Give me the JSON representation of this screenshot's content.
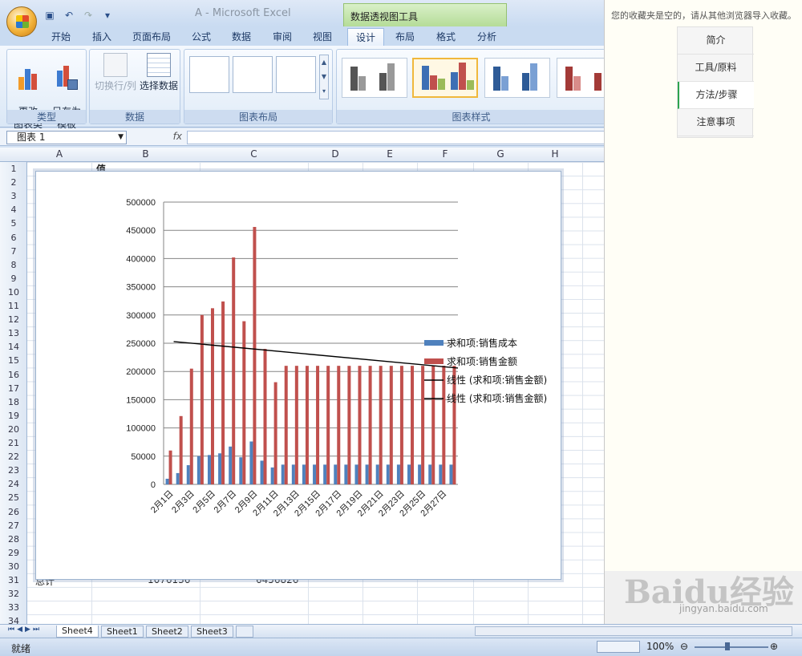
{
  "window": {
    "title": "A - Microsoft Excel",
    "context_tools": "数据透视图工具"
  },
  "qat": {
    "save_icon": "save-icon",
    "undo_icon": "undo-icon",
    "redo_icon": "redo-icon",
    "customize_icon": "dropdown-icon"
  },
  "tabs": [
    {
      "label": "开始"
    },
    {
      "label": "插入"
    },
    {
      "label": "页面布局"
    },
    {
      "label": "公式"
    },
    {
      "label": "数据"
    },
    {
      "label": "审阅"
    },
    {
      "label": "视图"
    },
    {
      "label": "设计"
    },
    {
      "label": "布局"
    },
    {
      "label": "格式"
    },
    {
      "label": "分析"
    }
  ],
  "ribbon": {
    "type_group": {
      "label": "类型",
      "change_type": "更改\n图表类型",
      "save_template": "另存为\n模板"
    },
    "data_group": {
      "label": "数据",
      "switch_row_col": "切换行/列",
      "select_data": "选择数据"
    },
    "layout_group": {
      "label": "图表布局"
    },
    "style_group": {
      "label": "图表样式"
    }
  },
  "formula_bar": {
    "name_box": "图表 1",
    "fx": "fx",
    "value": ""
  },
  "columns": [
    "A",
    "B",
    "C",
    "D",
    "E",
    "F",
    "G",
    "H"
  ],
  "rows": [
    "1",
    "2",
    "3",
    "4",
    "5",
    "6",
    "7",
    "8",
    "9",
    "10",
    "11",
    "12",
    "13",
    "14",
    "15",
    "16",
    "17",
    "18",
    "19",
    "20",
    "21",
    "22",
    "23",
    "24",
    "25",
    "26",
    "27",
    "28",
    "29",
    "30",
    "31",
    "32",
    "33",
    "34"
  ],
  "cells": {
    "b1": "值",
    "a31": "总计",
    "b31": "1076136",
    "c31": "6456826"
  },
  "chart_data": {
    "type": "bar",
    "categories": [
      "2月1日",
      "2月2日",
      "2月3日",
      "2月4日",
      "2月5日",
      "2月6日",
      "2月7日",
      "2月8日",
      "2月9日",
      "2月10日",
      "2月11日",
      "2月12日",
      "2月13日",
      "2月14日",
      "2月15日",
      "2月16日",
      "2月17日",
      "2月18日",
      "2月19日",
      "2月20日",
      "2月21日",
      "2月22日",
      "2月23日",
      "2月24日",
      "2月25日",
      "2月26日",
      "2月27日",
      "2月28日"
    ],
    "tick_labels": [
      "2月1日",
      "2月3日",
      "2月5日",
      "2月7日",
      "2月9日",
      "2月11日",
      "2月13日",
      "2月15日",
      "2月17日",
      "2月19日",
      "2月21日",
      "2月23日",
      "2月25日",
      "2月27日"
    ],
    "series": [
      {
        "name": "求和项:销售成本",
        "color": "#4f81bd",
        "values": [
          10000,
          20000,
          34000,
          50000,
          52000,
          55000,
          67000,
          48000,
          76000,
          42000,
          30000,
          35000,
          35000,
          35000,
          35000,
          35000,
          35000,
          35000,
          35000,
          35000,
          35000,
          35000,
          35000,
          35000,
          35000,
          35000,
          35000,
          35000
        ]
      },
      {
        "name": "求和项:销售金额",
        "color": "#c0504d",
        "values": [
          60000,
          121000,
          205000,
          300000,
          312000,
          324000,
          402000,
          289000,
          456000,
          240000,
          181000,
          210000,
          210000,
          210000,
          210000,
          210000,
          210000,
          210000,
          210000,
          210000,
          210000,
          210000,
          210000,
          210000,
          210000,
          210000,
          210000,
          210000
        ]
      }
    ],
    "trendlines": [
      {
        "name": "线性 (求和项:销售金额)",
        "start": 253000,
        "end": 206000
      },
      {
        "name": "线性 (求和项:销售金额)",
        "start": 253000,
        "end": 206000
      }
    ],
    "ylim": [
      0,
      500000
    ],
    "yticks": [
      0,
      50000,
      100000,
      150000,
      200000,
      250000,
      300000,
      350000,
      400000,
      450000,
      500000
    ],
    "grid": true,
    "legend_position": "right"
  },
  "sheets": [
    {
      "label": "Sheet4"
    },
    {
      "label": "Sheet1"
    },
    {
      "label": "Sheet2"
    },
    {
      "label": "Sheet3"
    }
  ],
  "status": {
    "ready": "就绪",
    "zoom": "100%"
  },
  "right_panel": {
    "message": "您的收藏夹是空的，请从其他浏览器导入收藏。",
    "nav": [
      {
        "label": "简介"
      },
      {
        "label": "工具/原料"
      },
      {
        "label": "方法/步骤"
      },
      {
        "label": "注意事项"
      }
    ]
  },
  "watermark": {
    "brand": "Baidu经验",
    "url": "jingyan.baidu.com"
  }
}
